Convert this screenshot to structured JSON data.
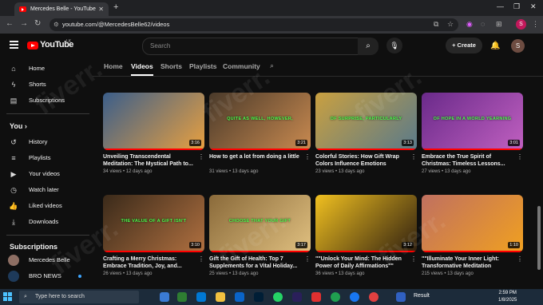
{
  "browser": {
    "tab_title": "Mercedes Belle - YouTube",
    "new_tab": "+",
    "url": "youtube.com/@MercedesBelle62/videos",
    "profile_initial": "S"
  },
  "masthead": {
    "logo_text": "YouTube",
    "country_code": "LK",
    "search_placeholder": "Search",
    "create_label": "+ Create",
    "avatar_initial": "S"
  },
  "sidebar": {
    "items": [
      {
        "label": "Home",
        "icon": "home-icon"
      },
      {
        "label": "Shorts",
        "icon": "shorts-icon"
      },
      {
        "label": "Subscriptions",
        "icon": "subscriptions-icon"
      }
    ],
    "you_header": "You",
    "you_items": [
      {
        "label": "History",
        "icon": "history-icon"
      },
      {
        "label": "Playlists",
        "icon": "playlists-icon"
      },
      {
        "label": "Your videos",
        "icon": "your-videos-icon"
      },
      {
        "label": "Watch later",
        "icon": "watch-later-icon"
      },
      {
        "label": "Liked videos",
        "icon": "liked-icon"
      },
      {
        "label": "Downloads",
        "icon": "download-icon"
      }
    ],
    "subs_header": "Subscriptions",
    "subs": [
      {
        "label": "Mercedes Belle"
      },
      {
        "label": "BRO NEWS"
      }
    ]
  },
  "channel_tabs": [
    "Home",
    "Videos",
    "Shorts",
    "Playlists",
    "Community"
  ],
  "videos": [
    {
      "title": "Unveiling Transcendental Meditation: The Mystical Path to...",
      "views": "34 views",
      "age": "12 days ago",
      "duration": "3:16",
      "caption": "",
      "c1": "#3b5e8a",
      "c2": "#e8a040"
    },
    {
      "title": "How to get a lot from doing a little",
      "views": "31 views",
      "age": "13 days ago",
      "duration": "3:21",
      "caption": "QUITE AS WELL, HOWEVER,",
      "c1": "#4a3a2a",
      "c2": "#c98a50"
    },
    {
      "title": "Colorful Stories: How Gift Wrap Colors Influence Emotions",
      "views": "23 views",
      "age": "13 days ago",
      "duration": "3:13",
      "caption": "OF SURPRISE, PARTICULARLY",
      "c1": "#c9a040",
      "c2": "#5a7a8a"
    },
    {
      "title": "Embrace the True Spirit of Christmas: Timeless Lessons...",
      "views": "27 views",
      "age": "13 days ago",
      "duration": "3:01",
      "caption": "OF HOPE IN A WORLD YEARNING",
      "c1": "#6a2a8a",
      "c2": "#c060c0"
    },
    {
      "title": "Crafting a Merry Christmas: Embrace Tradition, Joy, and...",
      "views": "26 views",
      "age": "13 days ago",
      "duration": "3:10",
      "caption": "THE VALUE OF A GIFT ISN'T",
      "c1": "#3a2a1a",
      "c2": "#b07040"
    },
    {
      "title": "Gift the Gift of Health: Top 7 Supplements for a Vital Holiday...",
      "views": "25 views",
      "age": "13 days ago",
      "duration": "3:17",
      "caption": "CHOOSE THAT YOUR GIFT",
      "c1": "#8a6a3a",
      "c2": "#e0c080"
    },
    {
      "title": "\"\"Unlock Your Mind: The Hidden Power of Daily Affirmations\"\"",
      "views": "36 views",
      "age": "13 days ago",
      "duration": "3:12",
      "caption": "",
      "c1": "#f0c020",
      "c2": "#302010"
    },
    {
      "title": "\"\"Illuminate Your Inner Light: Transformative Meditation Journe...",
      "views": "215 views",
      "age": "13 days ago",
      "duration": "1:10",
      "caption": "",
      "c1": "#c07060",
      "c2": "#f0a020"
    }
  ],
  "watermark": "fiverr.",
  "taskbar": {
    "search_placeholder": "Type here to search",
    "result_label": "Result",
    "time": "2:59 PM",
    "date": "1/8/2025"
  }
}
